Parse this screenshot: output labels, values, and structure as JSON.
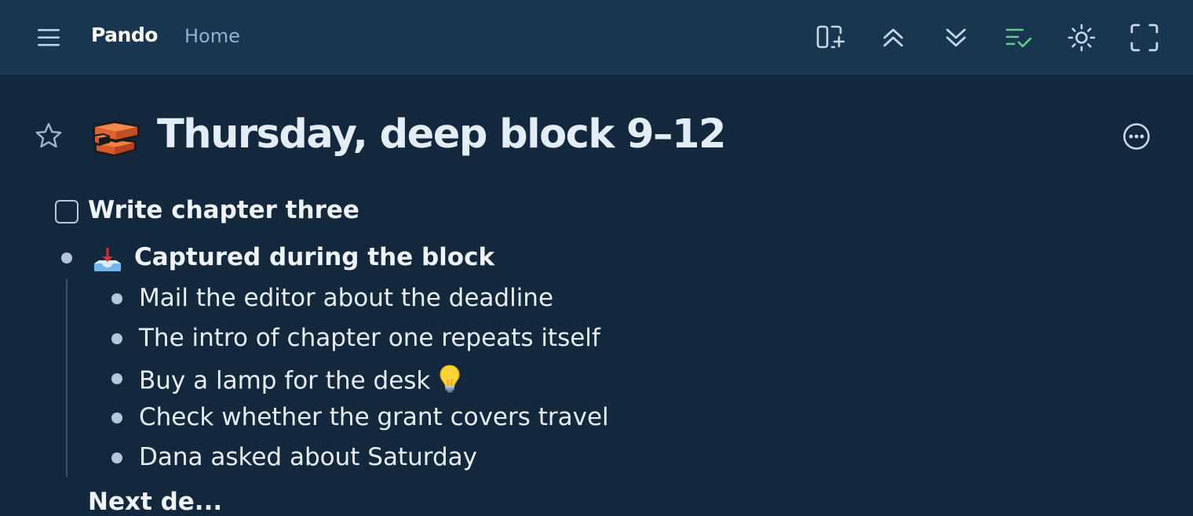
{
  "app": {
    "name": "Pando",
    "breadcrumb": "Home"
  },
  "toolbar": {
    "icons": [
      "menu-icon",
      "add-panel-icon",
      "collapse-all-icon",
      "expand-all-icon",
      "hide-completed-icon",
      "theme-toggle-icon",
      "fullscreen-icon"
    ],
    "accent_color": "#5fcf8a"
  },
  "page": {
    "title": "Thursday, deep block 9–12",
    "emoji": "bricks",
    "favorited": false
  },
  "outline": {
    "task": {
      "label": "Write chapter three",
      "checked": false
    },
    "group": {
      "emoji": "inbox-tray",
      "label": "Captured during the block",
      "items": [
        {
          "label": "Mail the editor about the deadline"
        },
        {
          "label": "The intro of chapter one repeats itself"
        },
        {
          "label": "Buy a lamp for the desk",
          "emoji": "light-bulb"
        },
        {
          "label": "Check whether the grant covers travel"
        },
        {
          "label": "Dana asked about Saturday"
        }
      ]
    },
    "partial_next_row": "Next de..."
  },
  "colors": {
    "background": "#13273d",
    "topbar": "#193650",
    "bullet": "#b3c6da"
  }
}
